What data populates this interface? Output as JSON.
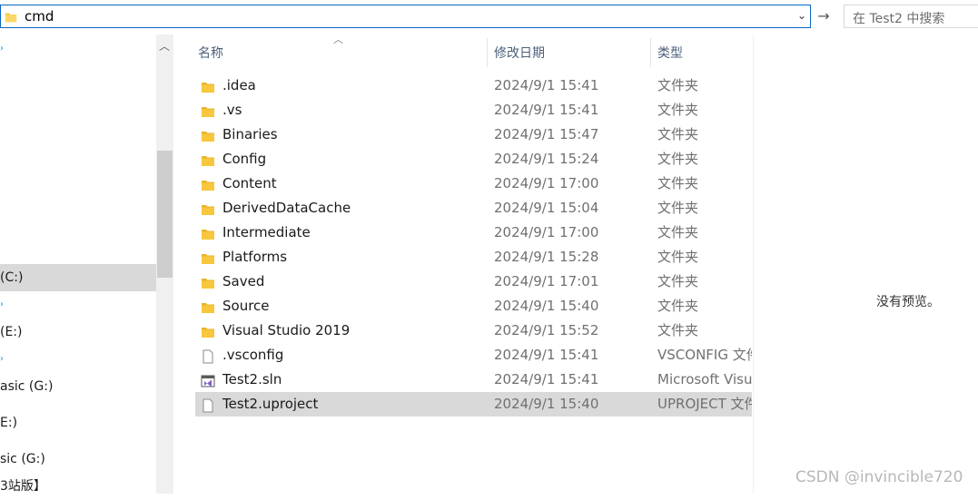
{
  "address": {
    "path": "cmd"
  },
  "search": {
    "placeholder": "在 Test2 中搜索"
  },
  "nav": {
    "items": [
      {
        "label": "(C:)",
        "selected": true
      },
      {
        "label": " (E:)",
        "selected": false
      },
      {
        "label": "asic (G:)",
        "selected": false
      },
      {
        "label": "E:)",
        "selected": false
      },
      {
        "label": "sic (G:)",
        "selected": false
      },
      {
        "label": "3站版】",
        "selected": false
      }
    ]
  },
  "columns": {
    "name": "名称",
    "date": "修改日期",
    "type": "类型"
  },
  "files": [
    {
      "name": ".idea",
      "date": "2024/9/1 15:41",
      "type": "文件夹",
      "icon": "folder-icon"
    },
    {
      "name": ".vs",
      "date": "2024/9/1 15:41",
      "type": "文件夹",
      "icon": "folder-icon"
    },
    {
      "name": "Binaries",
      "date": "2024/9/1 15:47",
      "type": "文件夹",
      "icon": "folder-icon"
    },
    {
      "name": "Config",
      "date": "2024/9/1 15:24",
      "type": "文件夹",
      "icon": "folder-icon"
    },
    {
      "name": "Content",
      "date": "2024/9/1 17:00",
      "type": "文件夹",
      "icon": "folder-icon"
    },
    {
      "name": "DerivedDataCache",
      "date": "2024/9/1 15:04",
      "type": "文件夹",
      "icon": "folder-icon"
    },
    {
      "name": "Intermediate",
      "date": "2024/9/1 17:00",
      "type": "文件夹",
      "icon": "folder-icon"
    },
    {
      "name": "Platforms",
      "date": "2024/9/1 15:28",
      "type": "文件夹",
      "icon": "folder-icon"
    },
    {
      "name": "Saved",
      "date": "2024/9/1 17:01",
      "type": "文件夹",
      "icon": "folder-icon"
    },
    {
      "name": "Source",
      "date": "2024/9/1 15:40",
      "type": "文件夹",
      "icon": "folder-icon"
    },
    {
      "name": "Visual Studio 2019",
      "date": "2024/9/1 15:52",
      "type": "文件夹",
      "icon": "folder-icon"
    },
    {
      "name": ".vsconfig",
      "date": "2024/9/1 15:41",
      "type": "VSCONFIG 文件",
      "icon": "file-icon"
    },
    {
      "name": "Test2.sln",
      "date": "2024/9/1 15:41",
      "type": "Microsoft Visual Studio Solution",
      "icon": "sln-icon"
    },
    {
      "name": "Test2.uproject",
      "date": "2024/9/1 15:40",
      "type": "UPROJECT 文件",
      "icon": "file-icon",
      "selected": true
    }
  ],
  "preview": {
    "message": "没有预览。"
  },
  "watermark": "CSDN @invincible720",
  "colors": {
    "selection": "#d9d9d9",
    "folder": "#f8c73e",
    "focus_border": "#0a66c2"
  }
}
